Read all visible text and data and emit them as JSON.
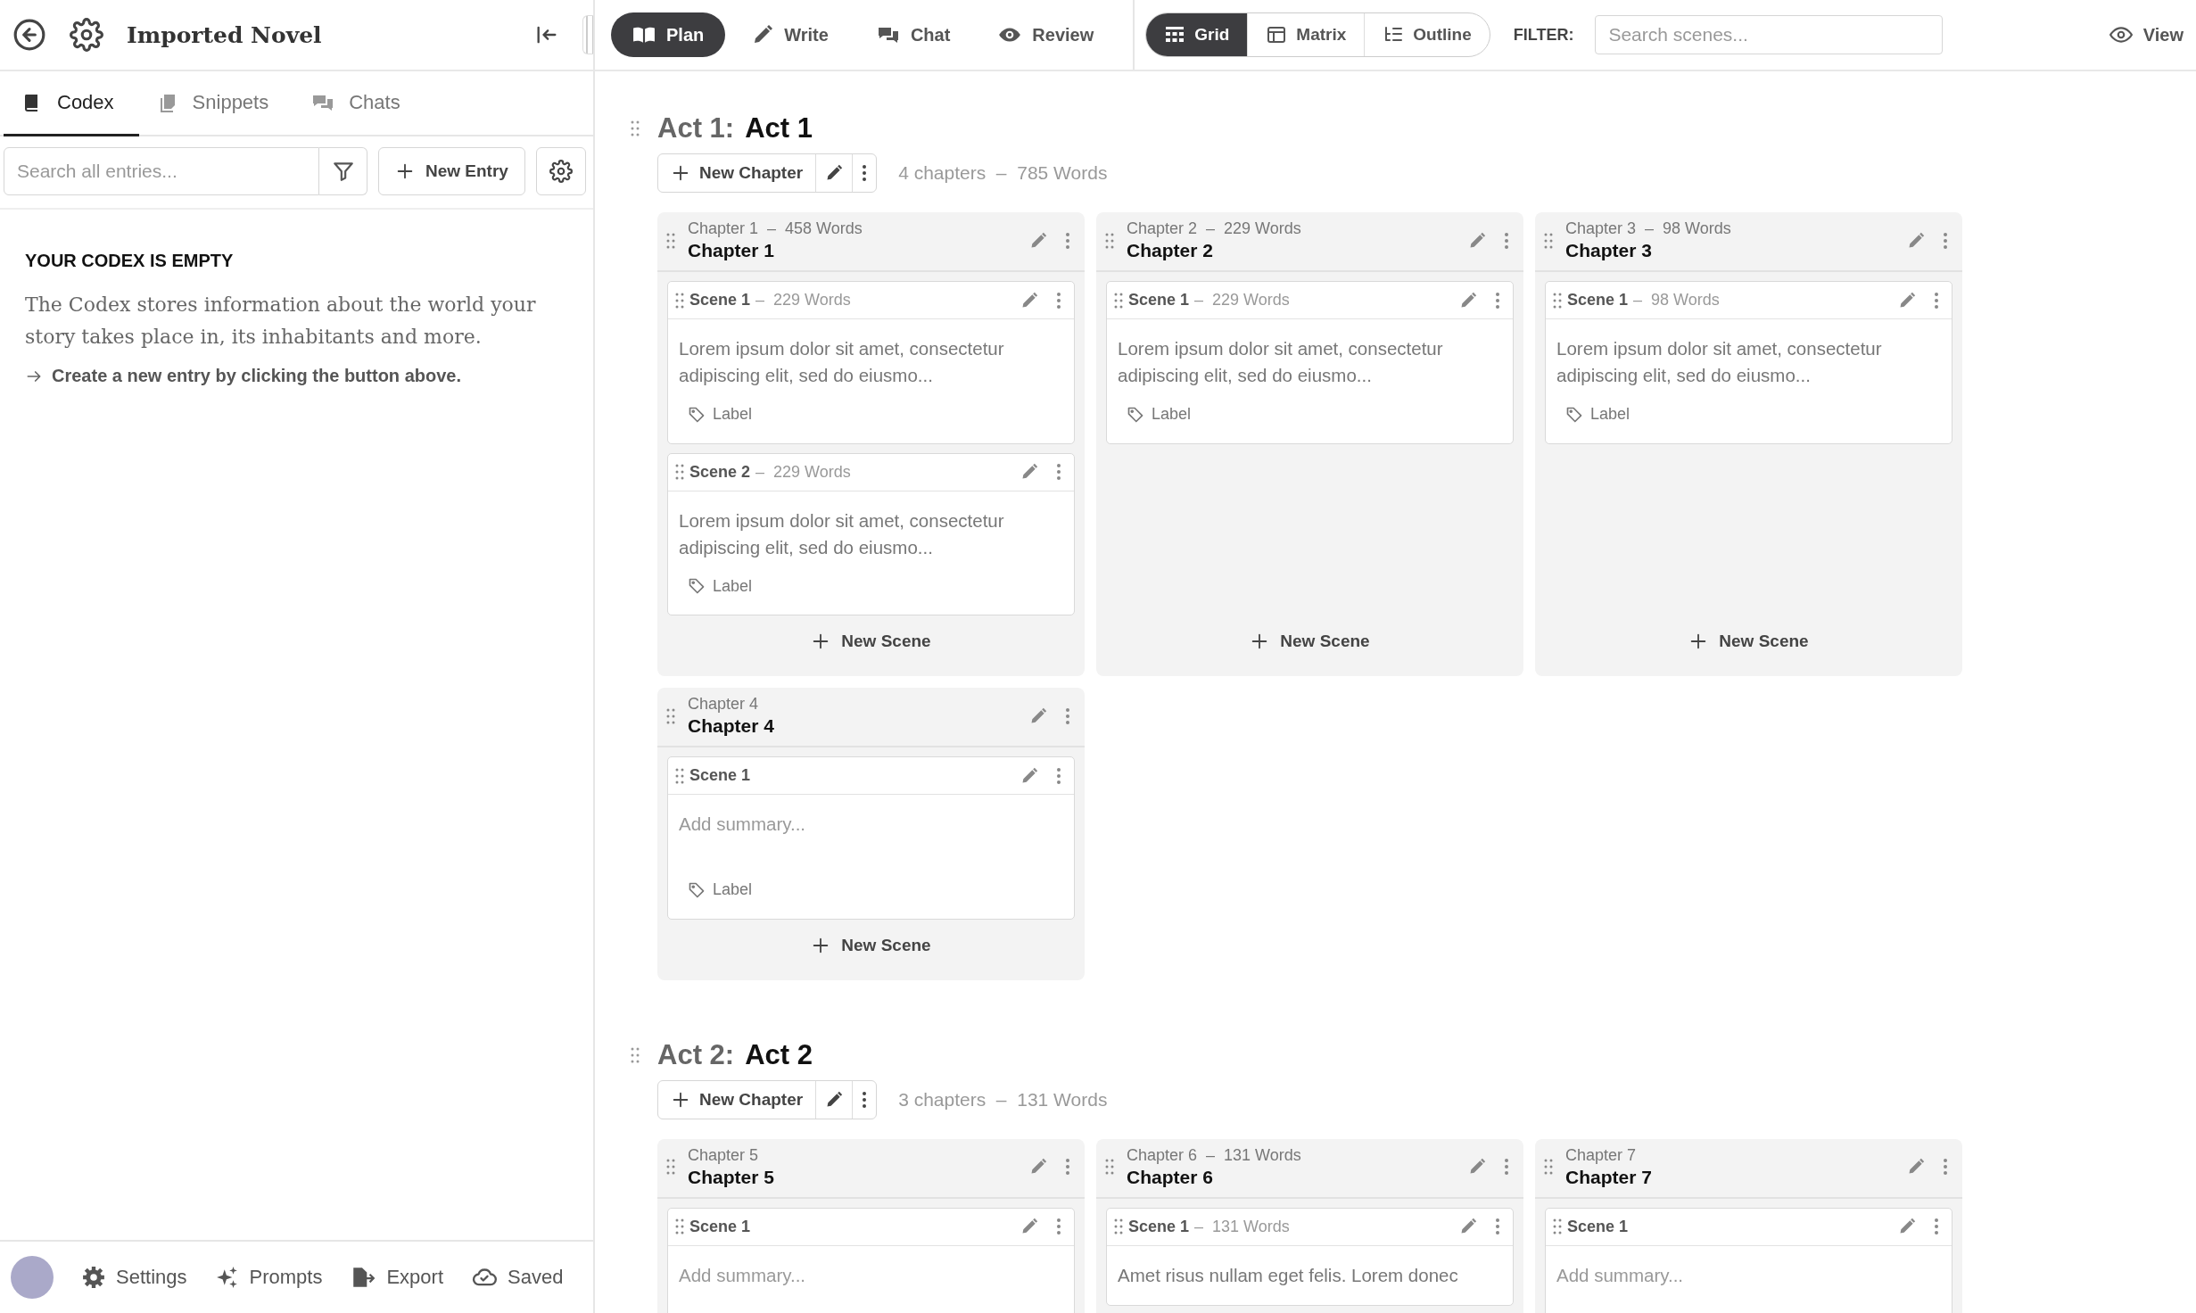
{
  "app": {
    "title": "Imported Novel"
  },
  "sidebar": {
    "tabs": [
      {
        "kind": "codex",
        "label": "Codex",
        "selected": true
      },
      {
        "kind": "snippets",
        "label": "Snippets",
        "selected": false
      },
      {
        "kind": "chats",
        "label": "Chats",
        "selected": false
      }
    ],
    "search": {
      "placeholder": "Search all entries..."
    },
    "new_entry": "New Entry",
    "empty": {
      "heading": "YOUR CODEX IS EMPTY",
      "text": "The Codex stores information about the world your story takes place in, its inhabitants and more.",
      "hint": "Create a new entry by clicking the button above."
    }
  },
  "modes": [
    {
      "kind": "plan",
      "label": "Plan",
      "selected": true
    },
    {
      "kind": "write",
      "label": "Write",
      "selected": false
    },
    {
      "kind": "chat",
      "label": "Chat",
      "selected": false
    },
    {
      "kind": "review",
      "label": "Review",
      "selected": false
    }
  ],
  "views": [
    {
      "kind": "grid",
      "label": "Grid",
      "selected": true
    },
    {
      "kind": "matrix",
      "label": "Matrix",
      "selected": false
    },
    {
      "kind": "outline",
      "label": "Outline",
      "selected": false
    }
  ],
  "filter": {
    "label": "FILTER:",
    "placeholder": "Search scenes..."
  },
  "view_button": "View",
  "acts": [
    {
      "number": "Act 1:",
      "title": "Act 1",
      "new_chapter": "New Chapter",
      "summary": "4 chapters  –  785 Words",
      "chapters": [
        {
          "meta": "Chapter 1  –  458 Words",
          "title": "Chapter 1",
          "new_scene": "New Scene",
          "scenes": [
            {
              "title": "Scene 1",
              "words": "–  229 Words",
              "summary": "Lorem ipsum dolor sit amet, consectetur adipiscing elit, sed do eiusmo...",
              "label": "Label"
            },
            {
              "title": "Scene 2",
              "words": "–  229 Words",
              "summary": "Lorem ipsum dolor sit amet, consectetur adipiscing elit, sed do eiusmo...",
              "label": "Label"
            }
          ]
        },
        {
          "meta": "Chapter 2  –  229 Words",
          "title": "Chapter 2",
          "new_scene": "New Scene",
          "scenes": [
            {
              "title": "Scene 1",
              "words": "–  229 Words",
              "summary": "Lorem ipsum dolor sit amet, consectetur adipiscing elit, sed do eiusmo...",
              "label": "Label"
            }
          ]
        },
        {
          "meta": "Chapter 3  –  98 Words",
          "title": "Chapter 3",
          "new_scene": "New Scene",
          "scenes": [
            {
              "title": "Scene 1",
              "words": "–  98 Words",
              "summary": "Lorem ipsum dolor sit amet, consectetur adipiscing elit, sed do eiusmo...",
              "label": "Label"
            }
          ]
        },
        {
          "meta": "Chapter 4",
          "title": "Chapter 4",
          "new_scene": "New Scene",
          "scenes": [
            {
              "title": "Scene 1",
              "placeholder": "Add summary...",
              "label": "Label"
            }
          ]
        }
      ]
    },
    {
      "number": "Act 2:",
      "title": "Act 2",
      "new_chapter": "New Chapter",
      "summary": "3 chapters  –  131 Words",
      "chapters": [
        {
          "meta": "Chapter 5",
          "title": "Chapter 5",
          "scenes": [
            {
              "title": "Scene 1",
              "placeholder": "Add summary..."
            }
          ]
        },
        {
          "meta": "Chapter 6  –  131 Words",
          "title": "Chapter 6",
          "scenes": [
            {
              "title": "Scene 1",
              "words": "–  131 Words",
              "summary": "Amet risus nullam eget felis. Lorem donec"
            }
          ]
        },
        {
          "meta": "Chapter 7",
          "title": "Chapter 7",
          "scenes": [
            {
              "title": "Scene 1",
              "placeholder": "Add summary..."
            }
          ]
        }
      ]
    }
  ],
  "footer": [
    {
      "kind": "settings",
      "label": "Settings"
    },
    {
      "kind": "prompts",
      "label": "Prompts"
    },
    {
      "kind": "export",
      "label": "Export"
    },
    {
      "kind": "saved",
      "label": "Saved"
    }
  ]
}
